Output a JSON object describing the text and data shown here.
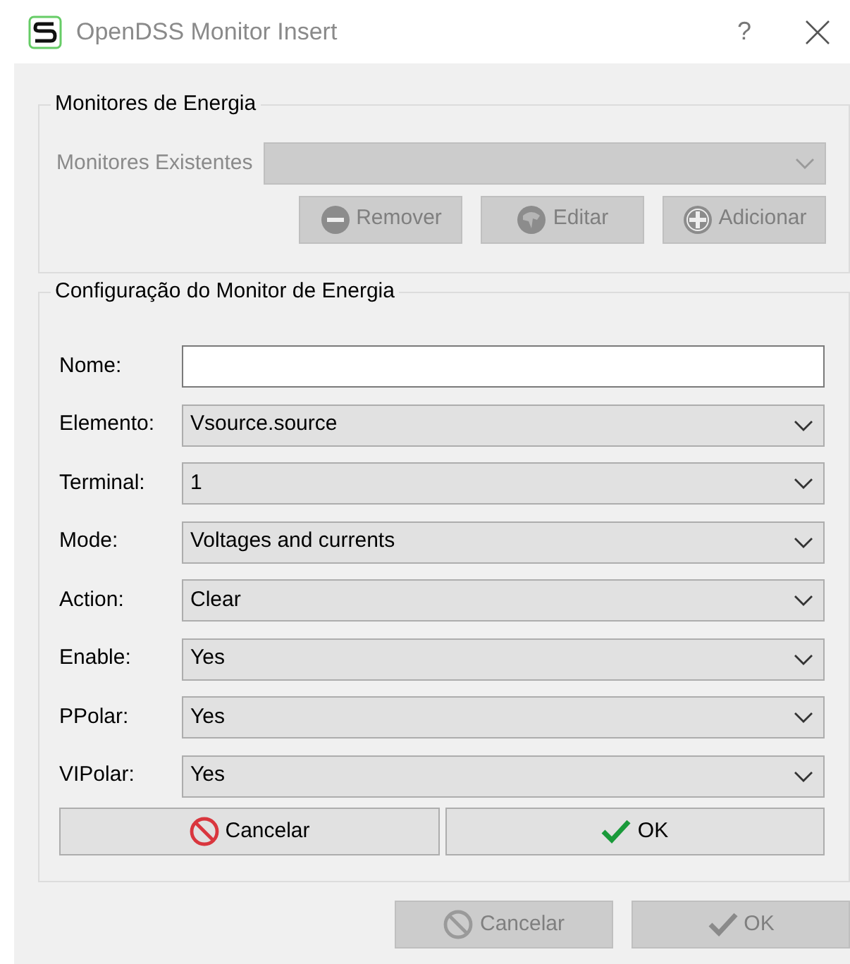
{
  "window": {
    "title": "OpenDSS Monitor Insert",
    "help": "?"
  },
  "monitors_group": {
    "title": "Monitores de Energia",
    "label": "Monitores Existentes",
    "combo": {
      "disabled": true
    },
    "buttons": [
      {
        "label": "Remover",
        "kind": "remove",
        "disabled": true
      },
      {
        "label": "Editar",
        "kind": "edit",
        "disabled": true
      },
      {
        "label": "Adicionar",
        "kind": "add",
        "disabled": true
      }
    ]
  },
  "config_group": {
    "title": "Configuração do Monitor de Energia",
    "fields": [
      {
        "label": "Nome:",
        "kind": "text"
      },
      {
        "label": "Elemento:",
        "kind": "combo",
        "value": "Vsource.source"
      },
      {
        "label": "Terminal:",
        "kind": "combo",
        "value": "1"
      },
      {
        "label": "Mode:",
        "kind": "combo",
        "value": "Voltages and currents"
      },
      {
        "label": "Action:",
        "kind": "combo",
        "value": "Clear"
      },
      {
        "label": "Enable:",
        "kind": "combo",
        "value": "Yes"
      },
      {
        "label": "PPolar:",
        "kind": "combo",
        "value": "Yes"
      },
      {
        "label": "VIPolar:",
        "kind": "combo",
        "value": "Yes"
      }
    ],
    "buttons": [
      {
        "label": "Cancelar",
        "kind": "cancel",
        "disabled": false
      },
      {
        "label": "OK",
        "kind": "ok",
        "disabled": false
      }
    ]
  },
  "footer_buttons": [
    {
      "label": "Cancelar",
      "kind": "cancel",
      "disabled": true
    },
    {
      "label": "OK",
      "kind": "ok",
      "disabled": true
    }
  ]
}
